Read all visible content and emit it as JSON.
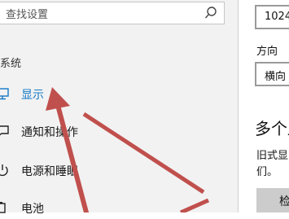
{
  "search": {
    "placeholder": "查找设置",
    "icon": "search-icon"
  },
  "sidebar": {
    "section_title": "系统",
    "items": [
      {
        "label": "显示",
        "icon": "monitor-icon",
        "active": true
      },
      {
        "label": "通知和操作",
        "icon": "chat-bubble-icon",
        "active": false
      },
      {
        "label": "电源和睡眠",
        "icon": "power-icon",
        "active": false
      },
      {
        "label": "电池",
        "icon": "battery-icon",
        "active": false
      }
    ]
  },
  "content": {
    "resolution_value": "1024",
    "orientation_label": "方向",
    "orientation_value": "横向",
    "multi_display_heading": "多个显",
    "legacy_text_line1": "旧式显",
    "legacy_text_line2": "们。",
    "button_label": "检"
  },
  "colors": {
    "accent": "#1479c4",
    "arrow": "#c0504d",
    "nav_background": "#f2f2f2"
  }
}
